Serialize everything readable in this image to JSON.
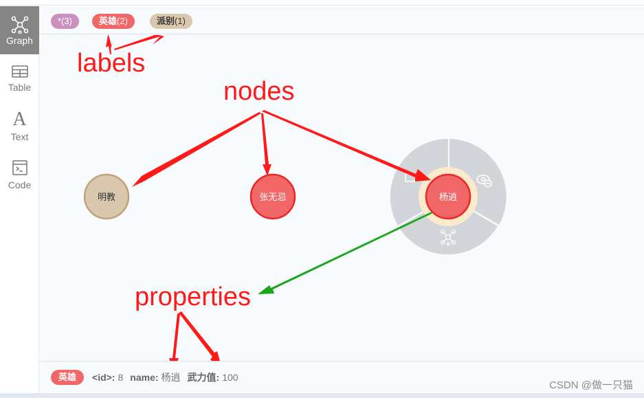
{
  "sidebar": {
    "items": [
      {
        "label": "Graph",
        "icon": "graph-icon",
        "active": true
      },
      {
        "label": "Table",
        "icon": "table-icon",
        "active": false
      },
      {
        "label": "Text",
        "icon": "text-icon",
        "active": false
      },
      {
        "label": "Code",
        "icon": "code-icon",
        "active": false
      }
    ]
  },
  "labels_bar": {
    "pills": [
      {
        "text": "*(3)",
        "color": "#c990c0"
      },
      {
        "name": "英雄",
        "count": "(2)",
        "color": "#f16667"
      },
      {
        "name": "派别",
        "count": "(1)",
        "color": "#d9c8ae"
      }
    ]
  },
  "graph": {
    "nodes": [
      {
        "caption": "明教",
        "label": "派别",
        "fill": "#d9c8ae",
        "stroke": "#c0a378",
        "text_color": "#333333"
      },
      {
        "caption": "张无忌",
        "label": "英雄",
        "fill": "#f16667",
        "stroke": "#eb2728",
        "text_color": "#ffffff"
      },
      {
        "caption": "杨逍",
        "label": "英雄",
        "fill": "#f16667",
        "stroke": "#eb2728",
        "text_color": "#ffffff",
        "selected": true
      }
    ],
    "ring_menu": {
      "color": "#d2d5da",
      "halo": "#fbeacc",
      "items": [
        "lock-icon",
        "hide-icon",
        "expand-icon"
      ]
    }
  },
  "annotations": {
    "labels": "labels",
    "nodes": "nodes",
    "properties": "properties",
    "red": "#ff1a1a",
    "green": "#1aa51a"
  },
  "footer": {
    "badge": "英雄",
    "badge_color": "#f16667",
    "properties": [
      {
        "key": "<id>:",
        "value": "8"
      },
      {
        "key": "name:",
        "value": "杨逍"
      },
      {
        "key": "武力值:",
        "value": "100"
      }
    ]
  },
  "watermark": "CSDN @做一只猫"
}
